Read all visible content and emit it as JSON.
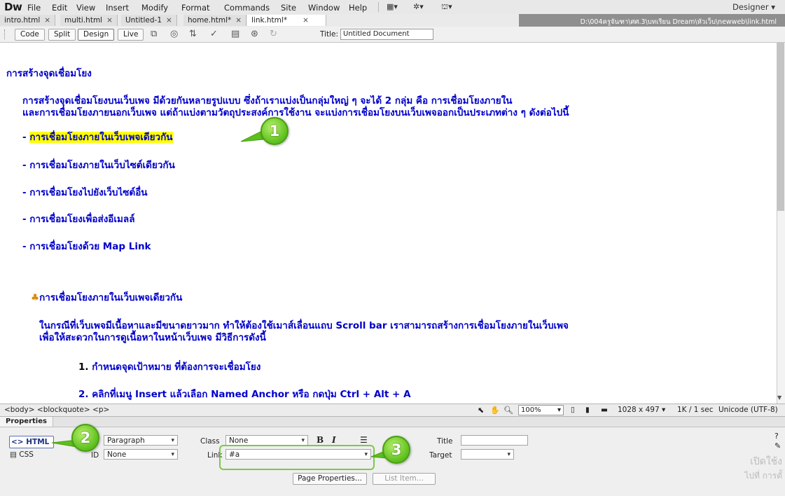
{
  "app": {
    "logo": "Dw",
    "menu": [
      "File",
      "Edit",
      "View",
      "Insert",
      "Modify",
      "Format",
      "Commands",
      "Site",
      "Window",
      "Help"
    ],
    "workspace": "Designer"
  },
  "tabs": [
    {
      "label": "intro.html",
      "close": "×"
    },
    {
      "label": "multi.html",
      "close": "×"
    },
    {
      "label": "Untitled-1",
      "close": "×"
    },
    {
      "label": "home.html*",
      "close": "×"
    },
    {
      "label": "link.html*",
      "close": "×"
    }
  ],
  "file_path": "D:\\004ครูจันฑา\\ศศ.3\\บทเรียน Dream\\หัวเว็บ\\newweb\\link.html",
  "doc_toolbar": {
    "views": [
      "Code",
      "Split",
      "Design",
      "Live"
    ],
    "title_label": "Title:",
    "title_value": "Untitled Document"
  },
  "content": {
    "heading": "การสร้างจุดเชื่อมโยง",
    "intro_line1": "การสร้างจุดเชื่อมโยงบนเว็บเพจ มีด้วยกันหลายรูปแบบ ซึ่งถ้าเราแบ่งเป็นกลุ่มใหญ่ ๆ จะได้ 2 กลุ่ม คือ การเชื่อมโยงภายใน",
    "intro_line2": "และการเชื่อมโยงภายนอกเว็บเพจ แต่ถ้าแบ่งตามวัตถุประสงค์การใช้งาน จะแบ่งการเชื่อมโยงบนเว็บเพจออกเป็นประเภทต่าง ๆ ดังต่อไปนี้",
    "bullet_dash": "-",
    "items": [
      "การเชื่อมโยงภายในเว็บเพจเดียวกัน",
      "- การเชื่อมโยงภายในเว็บไซต์เดียวกัน",
      "- การเชื่อมโยงไปยังเว็บไซต์อื่น",
      "- การเชื่อมโยงเพื่อส่งอีเมลล์",
      "- การเชื่อมโยงด้วย Map Link"
    ],
    "section_title": "การเชื่อมโยงภายในเว็บเพจเดียวกัน",
    "section_p1": "ในกรณีที่เว็บเพจมีเนื้อหาและมีขนาดยาวมาก ทำให้ต้องใช้เมาส์เลื่อนแถบ Scroll bar เราสามารถสร้างการเชื่อมโยงภายในเว็บเพจ",
    "section_p2": "เพื่อให้สะดวกในการดูเนื้อหาในหน้าเว็บเพจ มีวิธีการดังนี้",
    "step1_num": "1.",
    "step1": "กำหนดจุดเป้าหมาย ที่ต้องการจะเชื่อมโยง",
    "step2": "2. คลิกที่เมนู Insert แล้วเลือก  Named Anchor หรือ กดปุ่ม Ctrl + Alt + A"
  },
  "callouts": [
    "1",
    "2",
    "3"
  ],
  "statusbar": {
    "tag_selector": "<body> <blockquote> <p>",
    "zoom": "100%",
    "dimensions": "1028 x 497",
    "download": "1K / 1 sec",
    "encoding": "Unicode (UTF-8)"
  },
  "properties": {
    "title": "Properties",
    "html_btn": "<> HTML",
    "css_btn": "CSS",
    "format_value": "Paragraph",
    "id_label": "ID",
    "id_value": "None",
    "class_label": "Class",
    "class_value": "None",
    "link_label": "Link",
    "link_value": "#a",
    "title_label": "Title",
    "title_value": "",
    "target_label": "Target",
    "target_value": "",
    "bold": "B",
    "italic": "I",
    "page_properties": "Page Properties...",
    "list_item": "List Item..."
  },
  "watermark": {
    "line1": "เปิดใช้ง",
    "line2": "ไปที่ การตั้"
  },
  "colors": {
    "link_text": "#0000cc",
    "highlight": "#ffff00",
    "callout": "#5cbf1c"
  }
}
